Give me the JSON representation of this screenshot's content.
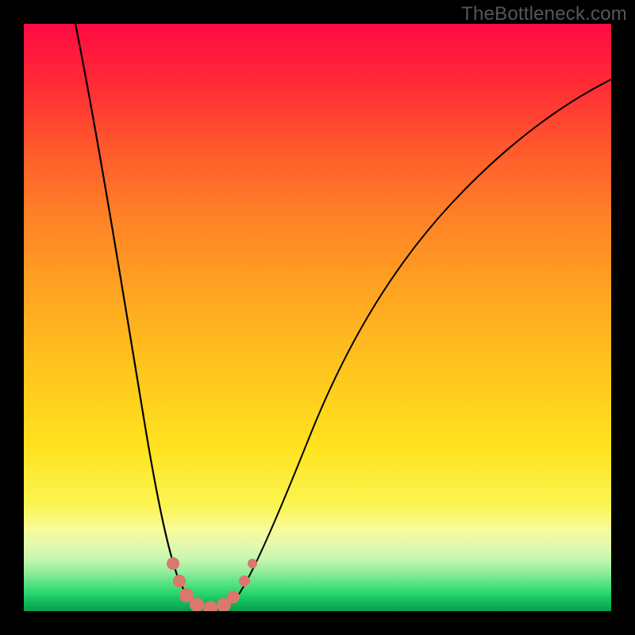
{
  "watermark": "TheBottleneck.com",
  "chart_data": {
    "type": "line",
    "title": "",
    "xlabel": "",
    "ylabel": "",
    "xlim": [
      0,
      100
    ],
    "ylim": [
      0,
      100
    ],
    "background_gradient": {
      "top": "#ff0a43",
      "middle": "#ffe31e",
      "bottom": "#0a9b4c",
      "meaning": "red=high bottleneck, green=optimal"
    },
    "series": [
      {
        "name": "left-branch",
        "x": [
          8.8,
          12.8,
          17.6,
          21.0,
          24.9,
          26.4,
          27.7
        ],
        "y": [
          100,
          80,
          50,
          30,
          16,
          5.4,
          2.7
        ]
      },
      {
        "name": "valley",
        "x": [
          27.7,
          29.7,
          32.2,
          34.6,
          36.5
        ],
        "y": [
          2.7,
          0.7,
          0.5,
          0.7,
          2.7
        ]
      },
      {
        "name": "right-branch",
        "x": [
          36.5,
          40.5,
          48.6,
          55.4,
          64.9,
          73.0,
          82.4,
          91.9,
          100
        ],
        "y": [
          2.7,
          6.8,
          16.2,
          29.7,
          46.6,
          59.5,
          69.6,
          79.7,
          90.5
        ]
      }
    ],
    "markers": {
      "name": "highlighted-points",
      "color": "#d9786b",
      "points": [
        {
          "x": 25.4,
          "y": 8.1
        },
        {
          "x": 26.5,
          "y": 5.1
        },
        {
          "x": 27.7,
          "y": 2.7
        },
        {
          "x": 29.5,
          "y": 1.1
        },
        {
          "x": 31.8,
          "y": 0.5
        },
        {
          "x": 34.1,
          "y": 1.1
        },
        {
          "x": 35.7,
          "y": 2.4
        },
        {
          "x": 37.6,
          "y": 5.1
        },
        {
          "x": 38.9,
          "y": 8.1
        }
      ]
    },
    "annotations": [
      {
        "text": "TheBottleneck.com",
        "position": "top-right"
      }
    ]
  }
}
